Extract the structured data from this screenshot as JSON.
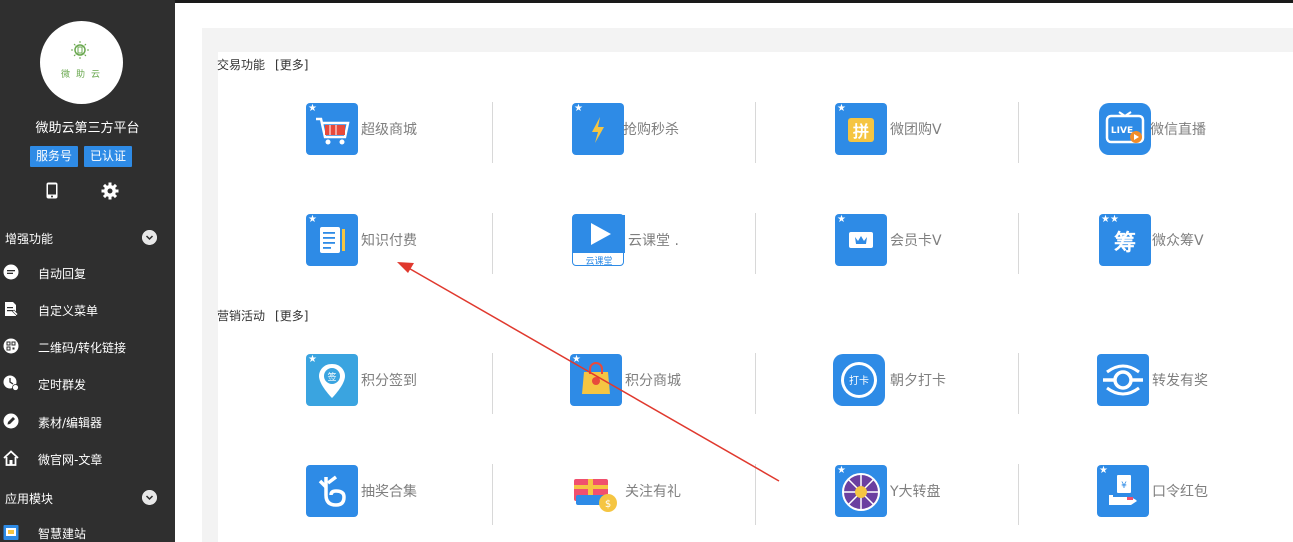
{
  "sidebar": {
    "avatar_text": "微助云",
    "account_name": "微助云第三方平台",
    "badges": [
      "服务号",
      "已认证"
    ],
    "section_enhance": "增强功能",
    "section_apps": "应用模块",
    "items": [
      {
        "label": "自动回复",
        "icon": "chat-bubble-icon"
      },
      {
        "label": "自定义菜单",
        "icon": "document-edit-icon"
      },
      {
        "label": "二维码/转化链接",
        "icon": "qrcode-icon"
      },
      {
        "label": "定时群发",
        "icon": "clock-icon"
      },
      {
        "label": "素材/编辑器",
        "icon": "pencil-icon"
      },
      {
        "label": "微官网-文章",
        "icon": "home-icon"
      },
      {
        "label": "智慧建站",
        "icon": "website-icon"
      }
    ]
  },
  "sections": [
    {
      "title": "交易功能",
      "more": "[更多]",
      "rows": [
        [
          "超级商城",
          "抢购秒杀",
          "微团购V",
          "微信直播"
        ],
        [
          "知识付费",
          "云课堂 .",
          "会员卡V",
          "微众筹V"
        ]
      ]
    },
    {
      "title": "营销活动",
      "more": "[更多]",
      "rows": [
        [
          "积分签到",
          "积分商城",
          "朝夕打卡",
          "转发有奖"
        ],
        [
          "抽奖合集",
          "关注有礼",
          "Y大转盘",
          "口令红包"
        ]
      ]
    }
  ],
  "icon_texts": {
    "live": "LIVE",
    "yunketang": "云课堂",
    "chou": "筹",
    "pin": "拼",
    "qian": "签",
    "daka": "打卡"
  },
  "colors": {
    "sidebar_bg": "#2f2f2f",
    "accent": "#2e8be6",
    "label_gray": "#7f7f7f",
    "arrow": "#e0392e"
  }
}
